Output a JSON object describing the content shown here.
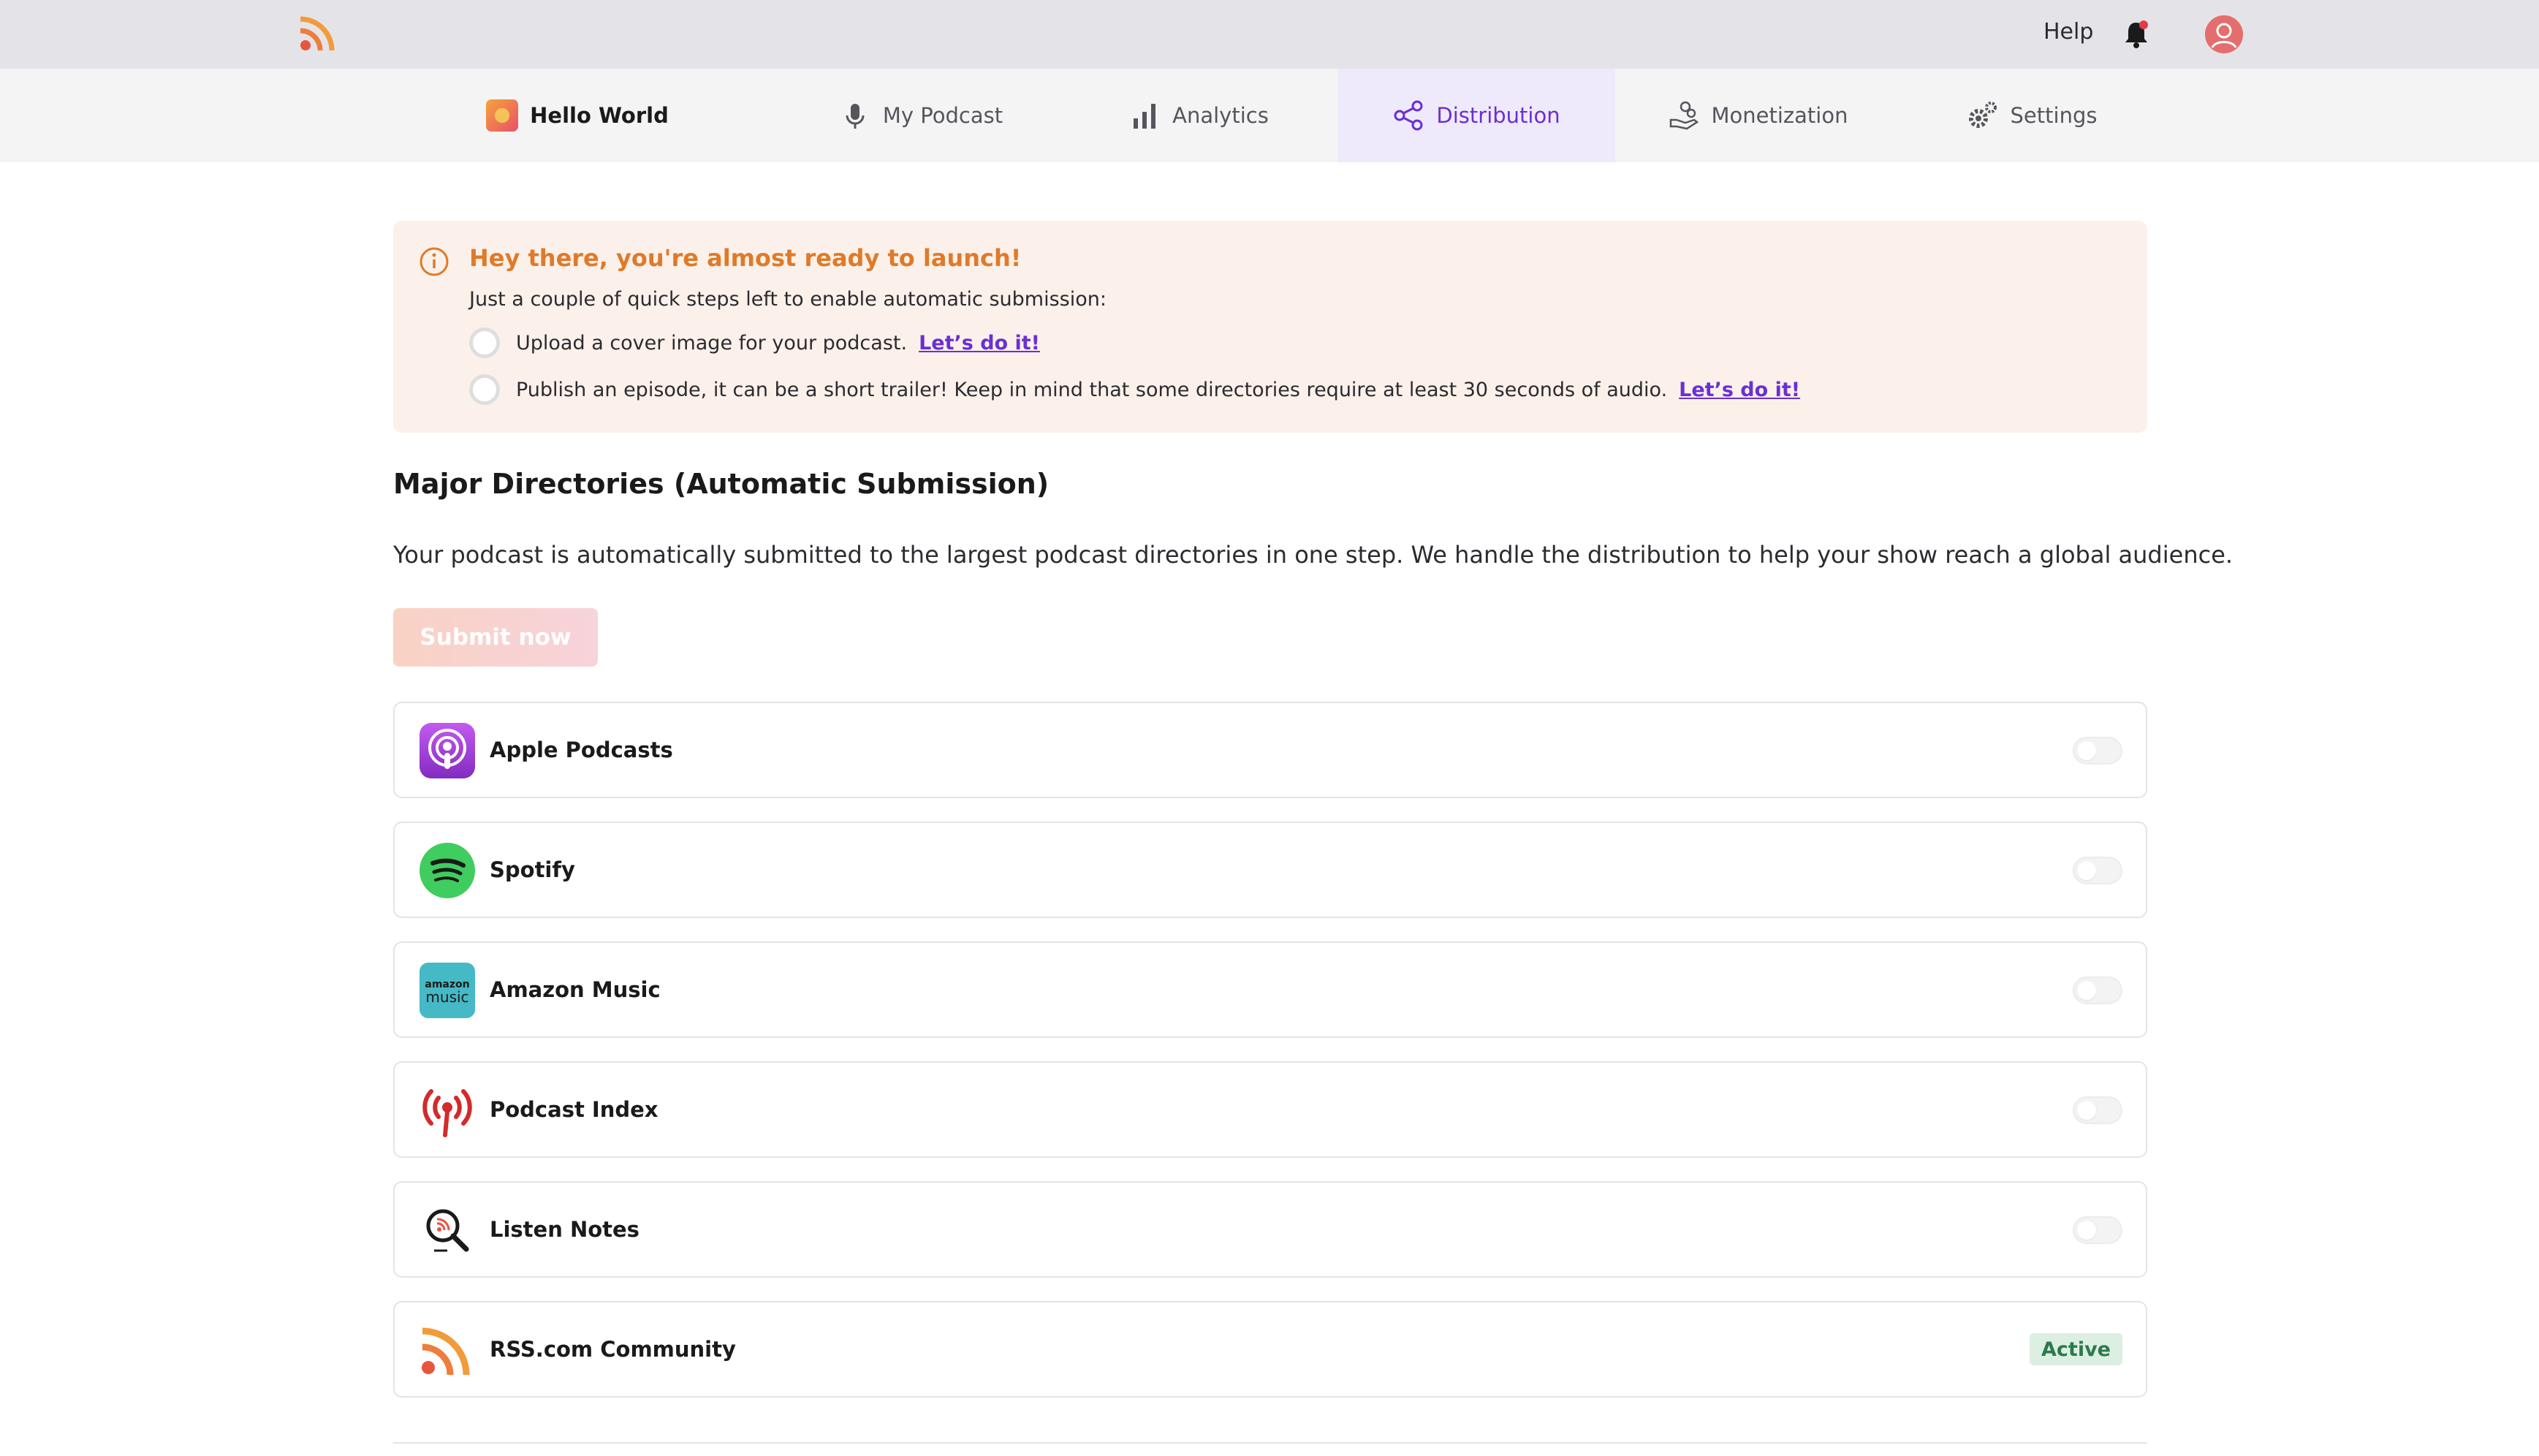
{
  "topbar": {
    "logo_icon": "rss-logo-icon",
    "help_label": "Help",
    "bell_icon": "bell-icon",
    "avatar_icon": "user-avatar-icon"
  },
  "nav": {
    "items": [
      {
        "label": "Hello World",
        "icon": "podcast-cover-thumbnail"
      },
      {
        "label": "My Podcast",
        "icon": "microphone-icon"
      },
      {
        "label": "Analytics",
        "icon": "bar-chart-icon"
      },
      {
        "label": "Distribution",
        "icon": "share-icon",
        "active": true
      },
      {
        "label": "Monetization",
        "icon": "hand-coins-icon"
      },
      {
        "label": "Settings",
        "icon": "gears-icon"
      }
    ]
  },
  "alert": {
    "title": "Hey there, you're almost ready to launch!",
    "subtitle": "Just a couple of quick steps left to enable automatic submission:",
    "steps": [
      {
        "text": "Upload a cover image for your podcast.",
        "link": "Let’s do it!"
      },
      {
        "text": "Publish an episode, it can be a short trailer! Keep in mind that some directories require at least 30 seconds of audio.",
        "link": "Let’s do it!"
      }
    ]
  },
  "section": {
    "title": "Major Directories (Automatic Submission)",
    "description": "Your podcast is automatically submitted to the largest podcast directories in one step. We handle the distribution to help your show reach a global audience.",
    "submit_label": "Submit now"
  },
  "directories": [
    {
      "name": "Apple Podcasts",
      "icon": "apple-podcasts-icon",
      "status": "off"
    },
    {
      "name": "Spotify",
      "icon": "spotify-icon",
      "status": "off"
    },
    {
      "name": "Amazon Music",
      "icon": "amazon-music-icon",
      "status": "off",
      "logo_text": [
        "amazon",
        "music"
      ]
    },
    {
      "name": "Podcast Index",
      "icon": "podcast-index-icon",
      "status": "off"
    },
    {
      "name": "Listen Notes",
      "icon": "listen-notes-icon",
      "status": "off"
    },
    {
      "name": "RSS.com Community",
      "icon": "rss-community-icon",
      "status": "active",
      "badge": "Active"
    }
  ],
  "colors": {
    "accent": "#6a2fd4",
    "alert_title": "#e07a2a",
    "alert_bg": "#fbf1ea",
    "active_badge_bg": "#dcefe2",
    "active_badge_text": "#2c7a4b"
  }
}
